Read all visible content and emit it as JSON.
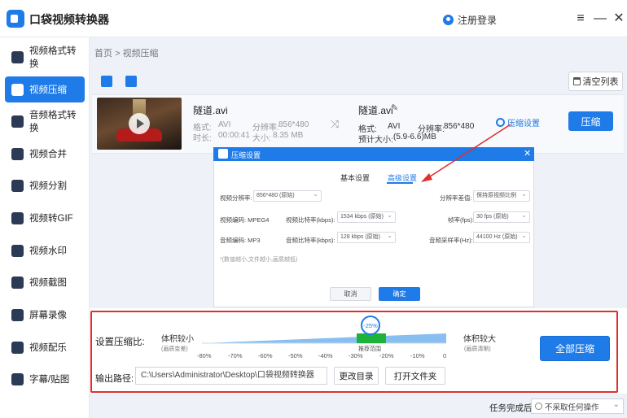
{
  "app": {
    "title": "口袋视频转换器",
    "login": "注册登录",
    "menu_icon": "menu-icon",
    "minimize_icon": "minimize-icon",
    "close_icon": "close-icon"
  },
  "sidebar": {
    "items": [
      {
        "label": "视频格式转换",
        "icon": "video-format-icon"
      },
      {
        "label": "视频压缩",
        "icon": "video-compress-icon",
        "active": true
      },
      {
        "label": "音频格式转换",
        "icon": "audio-format-icon"
      },
      {
        "label": "视频合并",
        "icon": "video-merge-icon"
      },
      {
        "label": "视频分割",
        "icon": "video-split-icon"
      },
      {
        "label": "视频转GIF",
        "icon": "gif-icon"
      },
      {
        "label": "视频水印",
        "icon": "watermark-icon"
      },
      {
        "label": "视频截图",
        "icon": "screenshot-icon"
      },
      {
        "label": "屏幕录像",
        "icon": "screen-record-icon"
      },
      {
        "label": "视频配乐",
        "icon": "music-icon"
      },
      {
        "label": "字幕/贴图",
        "icon": "subtitle-icon"
      }
    ]
  },
  "breadcrumb": {
    "home": "首页",
    "sep": ">",
    "current": "视频压缩"
  },
  "toolbar": {
    "clear": "清空列表"
  },
  "file": {
    "src_name": "隧道.avi",
    "format_label": "格式:",
    "format": "AVI",
    "resolution_label": "分辨率:",
    "resolution": "856*480",
    "duration_label": "时长:",
    "duration": "00:00:41",
    "size_label": "大小:",
    "size": "8.35 MB",
    "out_name": "隧道.avi",
    "out_format_label": "格式:",
    "out_format": "AVI",
    "out_resolution_label": "分辨率:",
    "out_resolution": "856*480",
    "estimate_label": "预计大小:",
    "estimate": "(5.9-6.6)MB",
    "settings_link": "压缩设置",
    "compress_btn": "压缩"
  },
  "dialog": {
    "title": "压缩设置",
    "close": "✕",
    "tab_basic": "基本设置",
    "tab_advanced": "高级设置",
    "resolution_label": "视频分辨率:",
    "resolution_value": "856*480 (原始)",
    "diff_label": "分辨率差值:",
    "diff_value": "保持原视频比例",
    "vcodec_label": "视频编码: MPEG4",
    "vbitrate_label": "视频比特率(kbps):",
    "vbitrate_value": "1534 kbps (原始)",
    "fps_label": "帧率(fps):",
    "fps_value": "30 fps (原始)",
    "acodec_label": "音频编码: MP3",
    "abitrate_label": "音频比特率(kbps):",
    "abitrate_value": "128 kbps (原始)",
    "asample_label": "音频采样率(Hz):",
    "asample_value": "44100 Hz (原始)",
    "hint": "*(数值越小,文件越小,画质越低)",
    "cancel": "取消",
    "ok": "确定"
  },
  "ratio": {
    "label": "设置压缩比:",
    "left_title": "体积较小",
    "left_sub": "(画质变差)",
    "right_title": "体积较大",
    "right_sub": "(画质清晰)",
    "value": "-25%",
    "range_label": "推荐范围",
    "ticks": [
      "-80%",
      "-70%",
      "-60%",
      "-50%",
      "-40%",
      "-30%",
      "-20%",
      "-10%",
      "0"
    ],
    "value_percent": -25
  },
  "output": {
    "label": "输出路径:",
    "path": "C:\\Users\\Administrator\\Desktop\\口袋视频转换器",
    "change_dir": "更改目录",
    "open_folder": "打开文件夹",
    "compress_all": "全部压缩"
  },
  "footer": {
    "task_label": "任务完成后",
    "task_value": "不采取任何操作"
  },
  "colors": {
    "accent": "#1f7be8",
    "highlight": "#e0302c",
    "range": "#1db33b"
  }
}
